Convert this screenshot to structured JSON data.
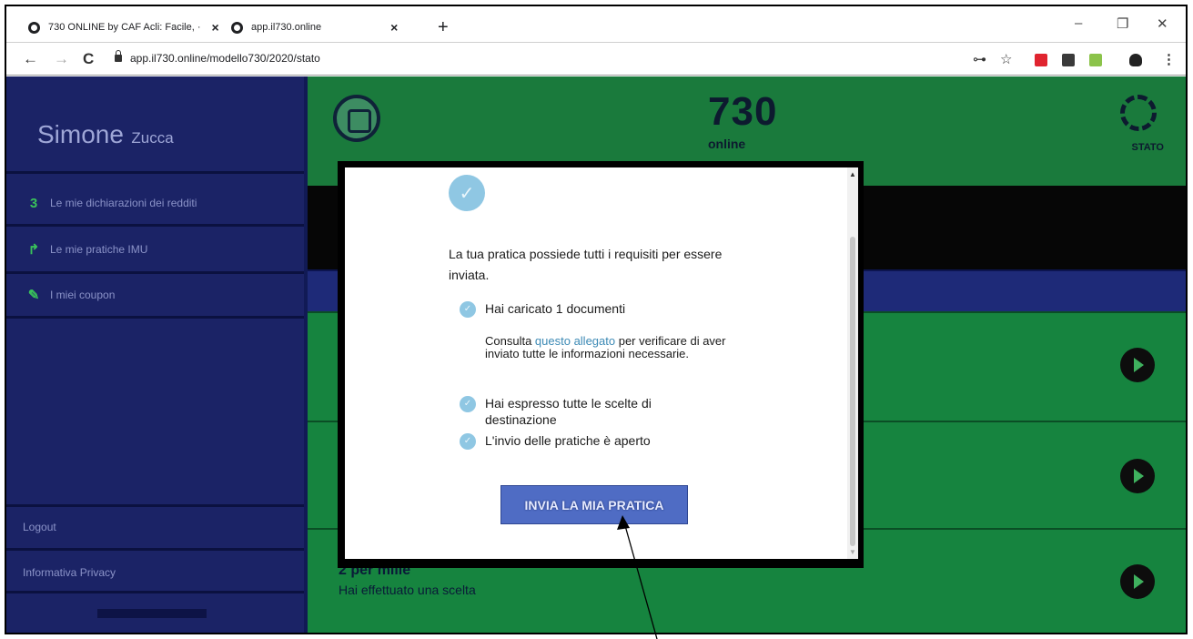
{
  "browser": {
    "tabs": [
      {
        "title": "730 ONLINE by CAF Acli: Facile, ·"
      },
      {
        "title": "app.il730.online"
      }
    ],
    "tab_close": "×",
    "new_tab": "+",
    "window_controls": {
      "minimize": "–",
      "restore": "❐",
      "close": "✕"
    },
    "url": "app.il730.online/modello730/2020/stato",
    "nav": {
      "back": "←",
      "forward": "→",
      "reload": "C"
    },
    "toolbar_icons": {
      "key": "⊶",
      "star": "☆",
      "menu": "⋮"
    },
    "extension_colors": [
      "#e0242f",
      "#3a3a3a",
      "#8bc34a"
    ]
  },
  "sidebar": {
    "user_first": "Simone",
    "user_last": "Zucca",
    "items": [
      {
        "label": "Le mie dichiarazioni dei redditi",
        "icon": "3"
      },
      {
        "label": "Le mie pratiche IMU",
        "icon": "↱"
      },
      {
        "label": "I miei coupon",
        "icon": "✎"
      }
    ],
    "logout": "Logout",
    "privacy": "Informativa Privacy"
  },
  "header": {
    "brand": "730",
    "brand_sub": "online",
    "status_label": "STATO"
  },
  "panels": {
    "last_title": "2 per mille",
    "last_subtitle": "Hai effettuato una scelta"
  },
  "modal": {
    "check_glyph": "✓",
    "lead": "La tua pratica possiede tutti i requisiti per essere inviata.",
    "req_documents": "Hai caricato 1 documenti",
    "note_before": "Consulta ",
    "note_link": "questo allegato",
    "note_after": " per verificare di aver inviato tutte le informazioni necessarie.",
    "req_choices": "Hai espresso tutte le scelte di destinazione",
    "req_open": "L'invio delle pratiche è aperto",
    "send_button": "INVIA LA MIA PRATICA",
    "scroll_up": "▲",
    "scroll_down": "▼"
  }
}
